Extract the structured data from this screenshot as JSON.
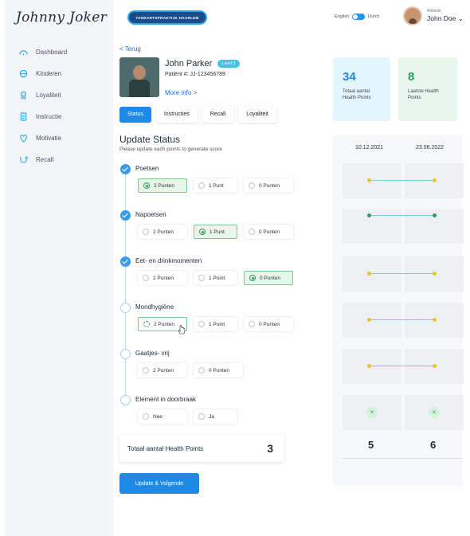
{
  "app": {
    "logo": "Johnny Joker"
  },
  "sidebar": {
    "items": [
      {
        "label": "Dashboard",
        "icon": "dashboard-icon"
      },
      {
        "label": "Kinderen",
        "icon": "children-icon"
      },
      {
        "label": "Loyaliteit",
        "icon": "loyalty-icon"
      },
      {
        "label": "Instructie",
        "icon": "instruction-icon"
      },
      {
        "label": "Motivatie",
        "icon": "motivation-icon"
      },
      {
        "label": "Recall",
        "icon": "recall-icon"
      }
    ]
  },
  "header": {
    "brand": "TANDARTSPRAKTIJK HAARLEM",
    "lang_left": "English",
    "lang_right": "Dutch",
    "welcome": "Welkom",
    "user_name": "John Doe ⌄"
  },
  "patient": {
    "back": "< Terug",
    "name": "John Parker",
    "level": "Level 3",
    "id": "Patiënt #: JJ-123456789",
    "more_info": "More info >"
  },
  "tabs": [
    "Status",
    "Instructies",
    "Recall",
    "Loyaliteit"
  ],
  "stats": [
    {
      "value": "34",
      "label": "Totaal aantal Health Points",
      "color": "#1e8ae6"
    },
    {
      "value": "8",
      "label": "Laatste Health Points",
      "color": "#2d9b5a"
    }
  ],
  "update": {
    "title": "Update Status",
    "subtitle": "Please update each points to generate score",
    "steps": [
      {
        "label": "Poetsen",
        "done": true,
        "options": [
          "2 Punten",
          "1 Punt",
          "0 Punten"
        ],
        "selected": 0
      },
      {
        "label": "Napoetsen",
        "done": true,
        "options": [
          "2 Punten",
          "1 Punt",
          "0 Punten"
        ],
        "selected": 1
      },
      {
        "label": "Eet- en drinkmomenten",
        "done": true,
        "options": [
          "2 Punten",
          "1 Point",
          "0 Punten"
        ],
        "selected": 2
      },
      {
        "label": "Mondhygiëne",
        "done": false,
        "options": [
          "2 Punten",
          "1 Point",
          "0 Punten"
        ],
        "selected": null
      },
      {
        "label": "Gaatjes- vrij",
        "done": false,
        "options": [
          "2 Punten",
          "0 Punten"
        ],
        "selected": null
      },
      {
        "label": "Element in doorbraak",
        "done": false,
        "options": [
          "Nee",
          "Ja"
        ],
        "selected": null
      }
    ],
    "total_label": "Totaal aantal Health Points",
    "total_value": "3",
    "submit": "Update & Volgende"
  },
  "history": {
    "dates": [
      "10.12.2021",
      "23.06.2022"
    ],
    "totals": [
      "5",
      "6"
    ],
    "x_mark": "×"
  },
  "colors": {
    "accent": "#1e8ae6",
    "success": "#2d9b5a",
    "yellow": "#e8c62c"
  }
}
